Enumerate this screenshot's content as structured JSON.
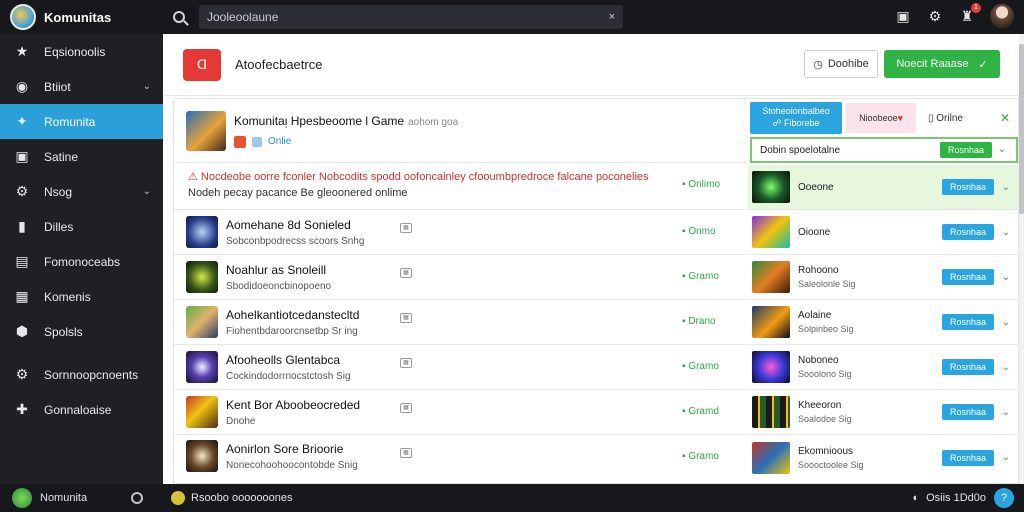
{
  "app": {
    "name": "Komunitas"
  },
  "search": {
    "placeholder": "Jooleoolaune",
    "clear": "×"
  },
  "colors": {
    "accent": "#2aa5e0",
    "success": "#2fb344",
    "danger": "#e53935",
    "sidebar": "#1e2024",
    "topbar": "#16181c"
  },
  "topbar": {
    "notification_count": "1"
  },
  "sidebar": {
    "items": [
      {
        "label": "Eqsionoolis",
        "icon": "star-icon",
        "glyph": "★"
      },
      {
        "label": "Btiiot",
        "icon": "circle-dollar-icon",
        "glyph": "◉"
      },
      {
        "label": "Romunita",
        "icon": "community-icon",
        "glyph": "✦"
      },
      {
        "label": "Satine",
        "icon": "monitor-icon",
        "glyph": "▣"
      },
      {
        "label": "Nsog",
        "icon": "gear-icon",
        "glyph": "⚙"
      },
      {
        "label": "Dilles",
        "icon": "bookmark-icon",
        "glyph": "▮"
      },
      {
        "label": "Fomonoceabs",
        "icon": "folder-icon",
        "glyph": "▤"
      },
      {
        "label": "Komenis",
        "icon": "list-icon",
        "glyph": "▦"
      },
      {
        "label": "Spolsls",
        "icon": "shield-icon",
        "glyph": "⬢"
      },
      {
        "label": "Sornnoopcnoents",
        "icon": "gear-icon",
        "glyph": "⚙"
      },
      {
        "label": "Gonnaloaise",
        "icon": "puzzle-icon",
        "glyph": "✚"
      }
    ]
  },
  "header": {
    "logo_text": "ᗡ",
    "title": "Atoofecbaetrce",
    "secondary_button": "Doohibe",
    "primary_button": "Noecit Raaase",
    "primary_icon": "✓"
  },
  "featured": {
    "title": "Komunitaᴉ Hpesbeoome l Game",
    "title_small": "aohom goa",
    "meta": "Onlie"
  },
  "alert": {
    "text_red": "Nocdeobe oorre fconler Nobcodits spodd oofoncainley cfooumbpredroce falcane poconelies",
    "text_dark": "Nodeh pecay pacance Be gleoonered onlime",
    "status": "Onlimo"
  },
  "games": [
    {
      "title": "Aomehane 8d Sonieled",
      "sub": "Sobconbpodrecss scoors Snhg",
      "status": "Onmo"
    },
    {
      "title": "Noahlur as Snoleill",
      "sub": "Sbodidoeoncbinopoeno",
      "status": "Gramo"
    },
    {
      "title": "Aohelkantiotcedanstecltd",
      "sub": "Fiohentbdaroorcnsetbp Sr ing",
      "status": "Drano"
    },
    {
      "title": "Afooheolls Glentabca",
      "sub": "Cockindodorrnocstctosh Sig",
      "status": "Gramo"
    },
    {
      "title": "Kent Bor Aboobeocreded",
      "sub": "Dnohe",
      "status": "Gramd"
    },
    {
      "title": "Aonirlon Sore Brioorie",
      "sub": "Nonecohoohoocontobde Snig",
      "status": "Gramo"
    }
  ],
  "right_panel": {
    "tab_blue_line1": "Stoheoionbalbeo",
    "tab_blue_line2": "☍ Fiborebe",
    "tab_pink": "Nioobeoe",
    "tab_online": "Orilne",
    "filter_label": "Dobin spoelotalne",
    "filter_button": "Rosnhaa",
    "rows": [
      {
        "title": "Ooeone",
        "sub": "",
        "button": "Rosnhaa"
      },
      {
        "title": "Oioone",
        "sub": "",
        "button": "Rosnhaa"
      },
      {
        "title": "Rohoono",
        "sub": "Saleolonle Sig",
        "button": "Rosnhaa"
      },
      {
        "title": "Aolaine",
        "sub": "Solpinbeo Sig",
        "button": "Rosnhaa"
      },
      {
        "title": "Noboneo",
        "sub": "Sooolono Sig",
        "button": "Rosnhaa"
      },
      {
        "title": "Kheeoron",
        "sub": "Soalodoe Sig",
        "button": "Rosnhaa"
      },
      {
        "title": "Ekomnioous",
        "sub": "Soooctoolee Sig",
        "button": "Rosnhaa"
      }
    ]
  },
  "bottombar": {
    "brand": "Nomunita",
    "status": "Rsoobo ooooooones",
    "right_text": "Osiis 1Dd0o",
    "help": "?"
  }
}
